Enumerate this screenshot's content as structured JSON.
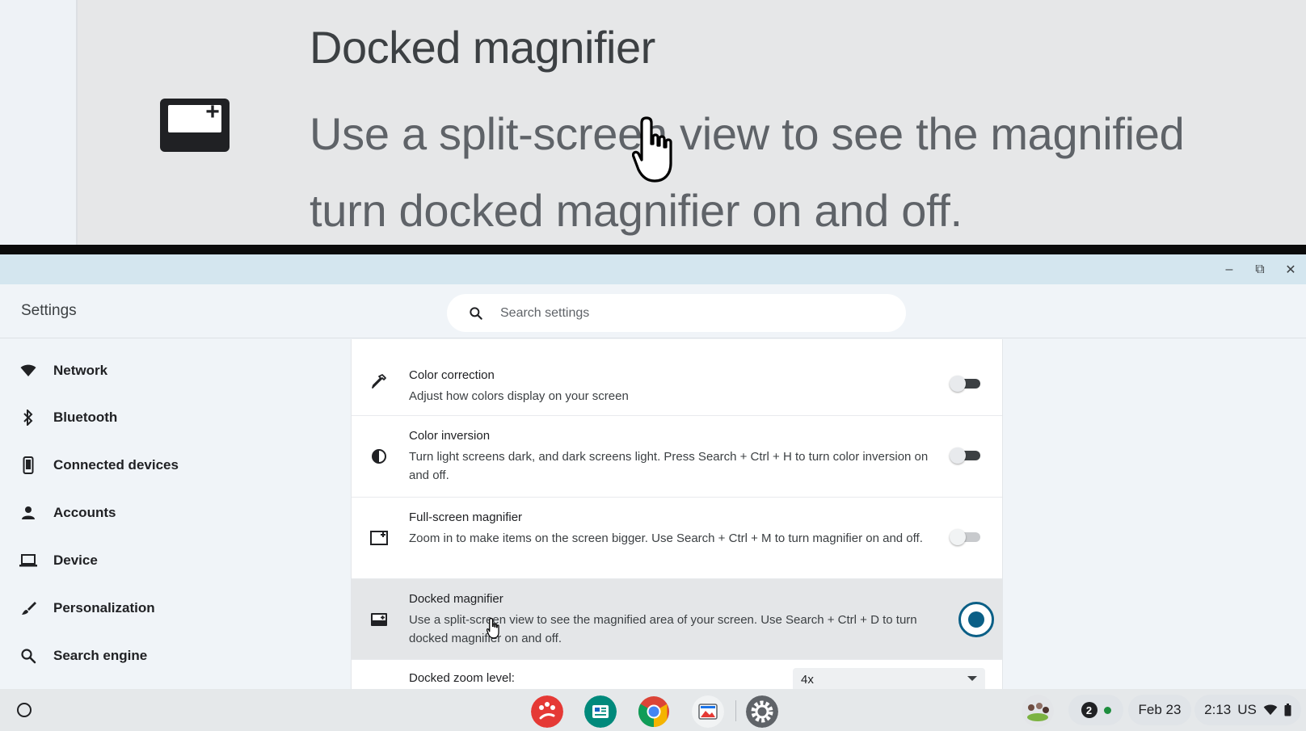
{
  "magnifier_view": {
    "title": "Docked magnifier",
    "desc_line1": "Use a split-screen view to see the magnified",
    "desc_line2": "turn docked magnifier on and off."
  },
  "window": {
    "controls": {
      "minimize": "–",
      "restore": "⧉",
      "close": "✕"
    }
  },
  "header": {
    "app_title": "Settings",
    "search_placeholder": "Search settings"
  },
  "sidebar": {
    "items": [
      {
        "label": "Network",
        "icon": "wifi-icon"
      },
      {
        "label": "Bluetooth",
        "icon": "bluetooth-icon"
      },
      {
        "label": "Connected devices",
        "icon": "phone-icon"
      },
      {
        "label": "Accounts",
        "icon": "person-icon"
      },
      {
        "label": "Device",
        "icon": "laptop-icon"
      },
      {
        "label": "Personalization",
        "icon": "brush-icon"
      },
      {
        "label": "Search engine",
        "icon": "search-icon"
      }
    ]
  },
  "settings": {
    "rows": [
      {
        "title": "Color correction",
        "desc": "Adjust how colors display on your screen",
        "icon": "eyedropper-icon",
        "toggle": "off"
      },
      {
        "title": "Color inversion",
        "desc": "Turn light screens dark, and dark screens light. Press Search + Ctrl + H to turn color inversion on and off.",
        "icon": "contrast-icon",
        "toggle": "off"
      },
      {
        "title": "Full-screen magnifier",
        "desc": "Zoom in to make items on the screen bigger. Use Search + Ctrl + M to turn magnifier on and off.",
        "icon": "fullscreen-magnifier-icon",
        "toggle": "disabled"
      },
      {
        "title": "Docked magnifier",
        "desc": "Use a split-screen view to see the magnified area of your screen. Use Search + Ctrl + D to turn docked magnifier on and off.",
        "icon": "docked-magnifier-icon",
        "toggle": "focused"
      }
    ],
    "zoom": {
      "label": "Docked zoom level:",
      "value": "4x"
    }
  },
  "shelf": {
    "apps": [
      "paint-app-icon",
      "news-app-icon",
      "chrome-icon",
      "gallery-app-icon",
      "settings-app-icon"
    ],
    "notification_count": "2",
    "date": "Feb 23",
    "time": "2:13",
    "locale": "US"
  },
  "colors": {
    "accent": "#0b5f86",
    "titlebar": "#d4e6ef",
    "background": "#f0f4f8"
  }
}
